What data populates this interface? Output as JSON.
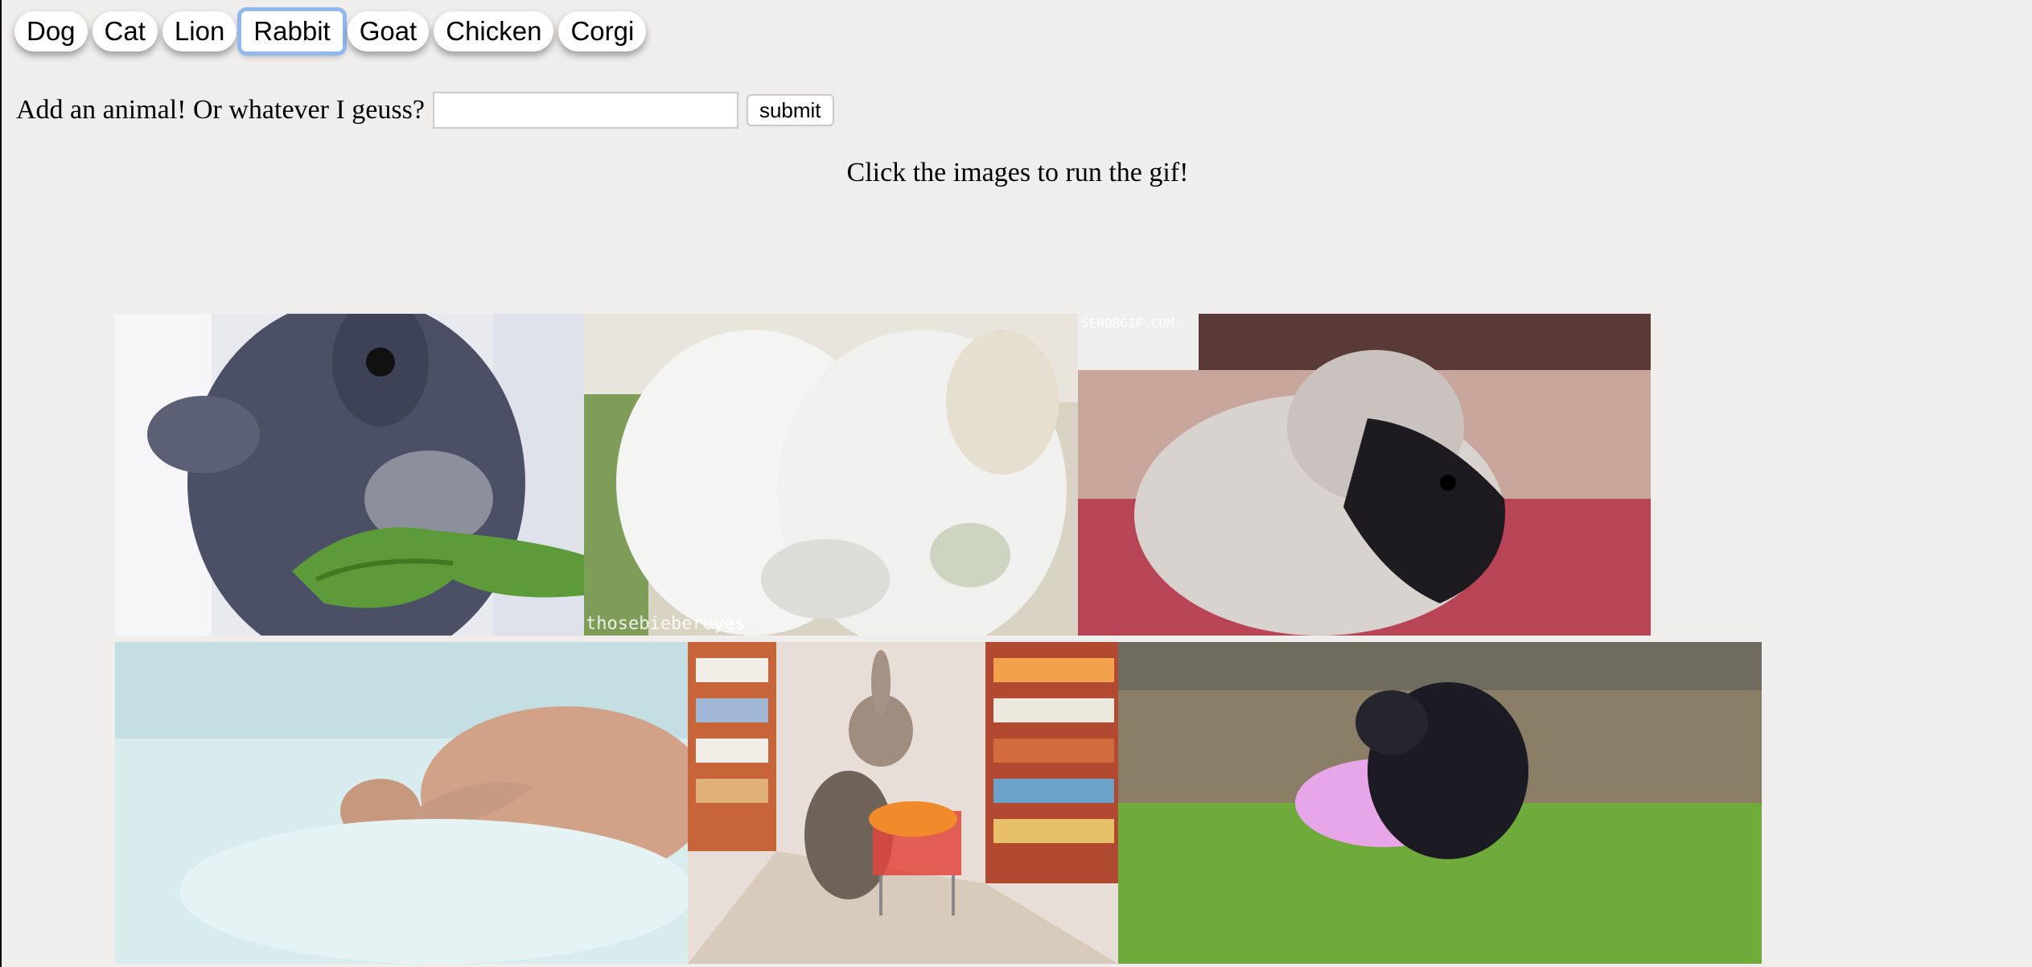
{
  "nav": {
    "buttons": [
      {
        "label": "Dog"
      },
      {
        "label": "Cat"
      },
      {
        "label": "Lion"
      },
      {
        "label": "Rabbit",
        "active": true
      },
      {
        "label": "Goat"
      },
      {
        "label": "Chicken"
      },
      {
        "label": "Corgi"
      }
    ]
  },
  "form": {
    "label": "Add an animal! Or whatever I geuss?",
    "input_value": "",
    "submit_label": "submit"
  },
  "hint": "Click the images to run the gif!",
  "gifs": {
    "g2_watermark": "thosebiebereyes",
    "g3_watermark": "SENORGIF.COM"
  },
  "colors": {
    "background": "#f0eded",
    "active_outline": "#8fb8ee"
  }
}
